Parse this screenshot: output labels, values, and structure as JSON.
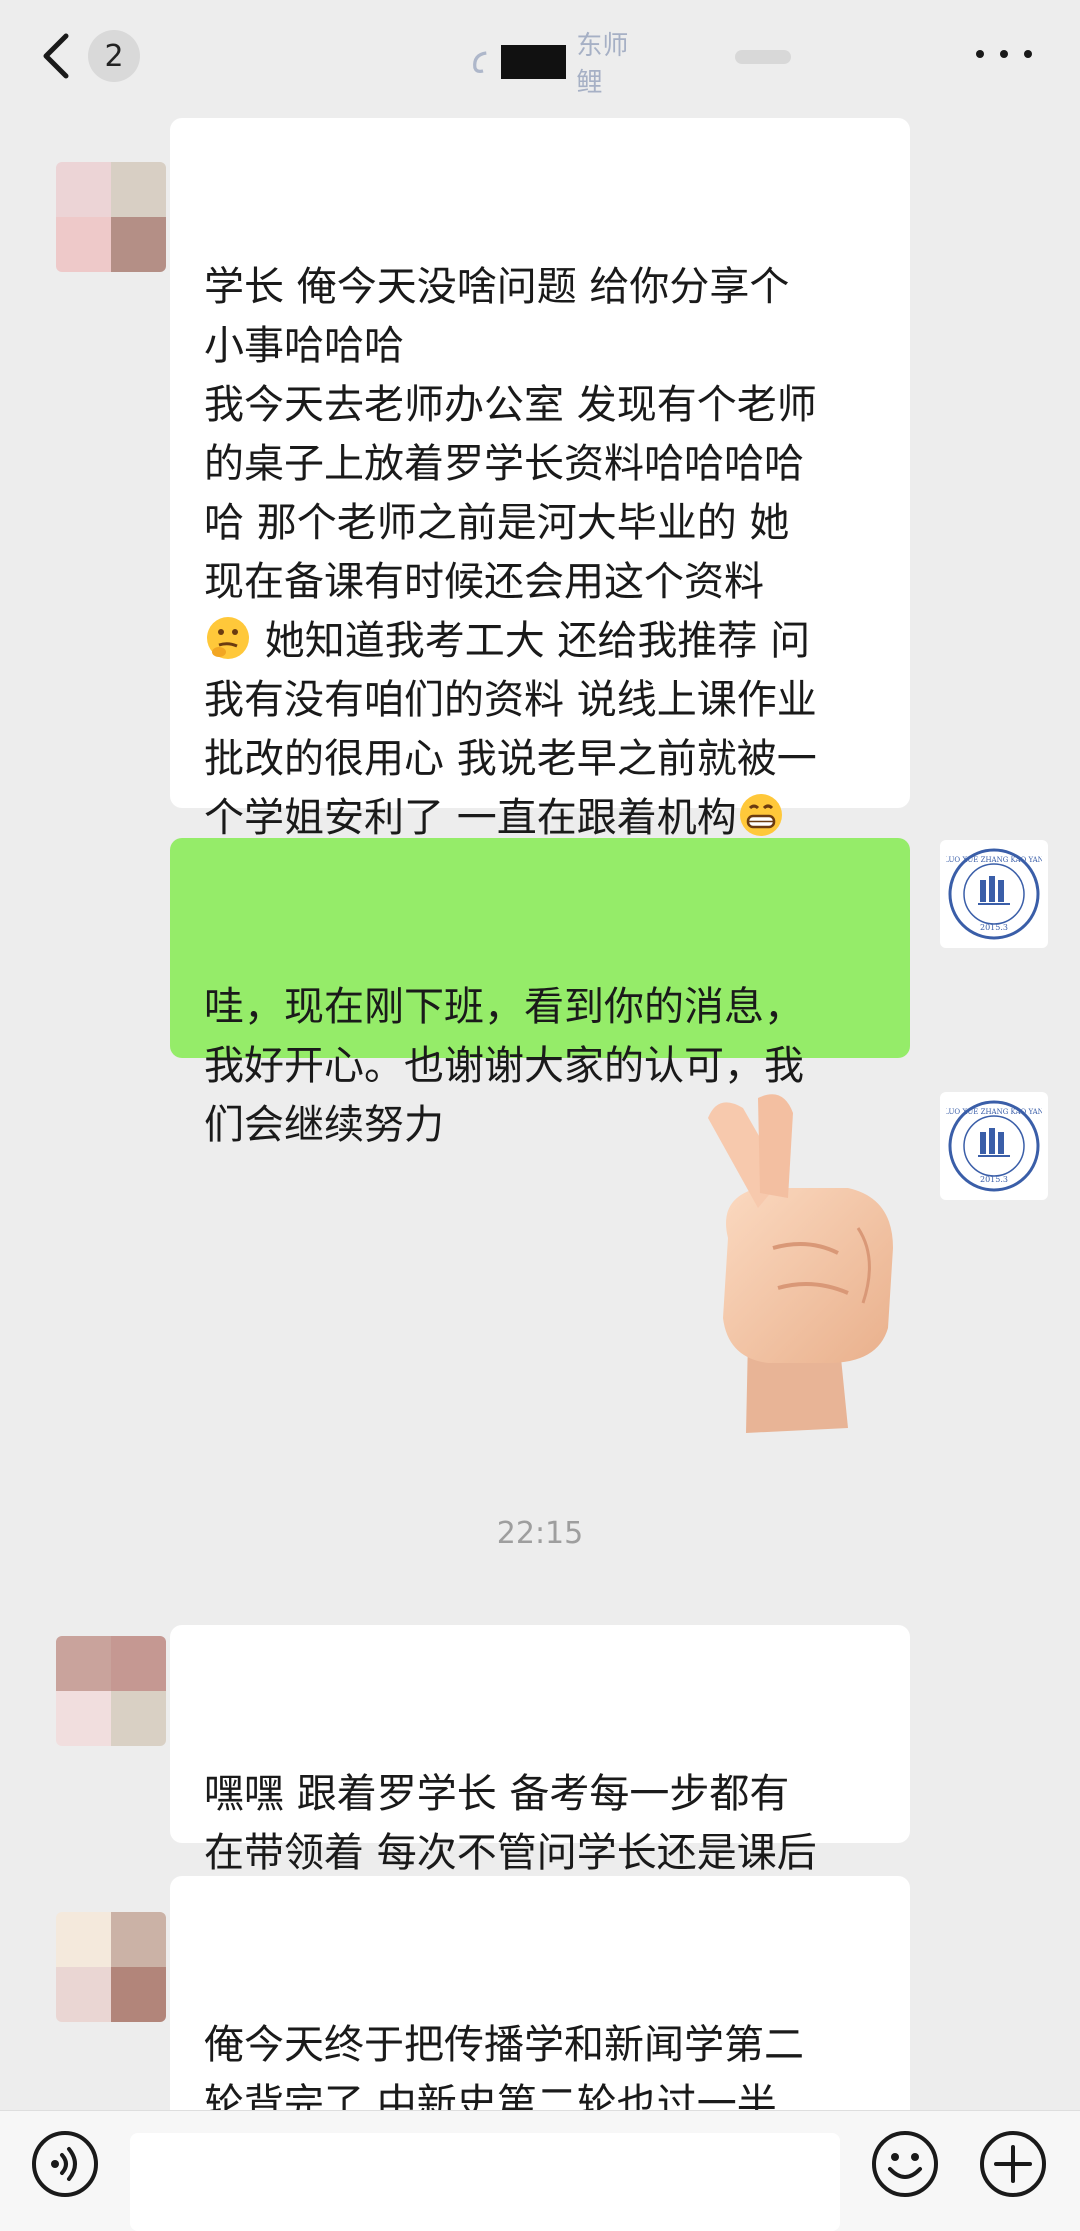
{
  "header": {
    "unread_count": "2",
    "title_visible": "东师鲤",
    "back_icon": "chevron-left-icon",
    "more_icon": "more-dots-icon"
  },
  "messages": {
    "m1_lines": [
      "学长 俺今天没啥问题 给你分享个",
      "小事哈哈哈",
      "我今天去老师办公室 发现有个老师",
      "的桌子上放着罗学长资料哈哈哈哈",
      "哈 那个老师之前是河大毕业的 她",
      "现在备课有时候还会用这个资料"
    ],
    "m1_line7": " 她知道我考工大 还给我推荐 问",
    "m1_line8": "我有没有咱们的资料 说线上课作业",
    "m1_line9": "批改的很用心 我说老早之前就被一",
    "m1_line10": "个学姐安利了 一直在跟着机构",
    "m2": "哇，现在刚下班，看到你的消息，\n我好开心。也谢谢大家的认可，我\n们会继续努力",
    "m3": "嘿嘿 跟着罗学长 备考每一步都有\n在带领着 每次不管问学长还是课后\n问学姐都有很耐心的答复",
    "m4": "俺今天终于把传播学和新闻学第二\n轮背完了 中新史第二轮也过一半\n了 虽然进度不是很快 但感觉比刚\n进九月时候心态上好了很多 答题也"
  },
  "timestamp": "22:15",
  "logo_avatar": {
    "arc_text": "LUO XUE ZHANG KAO YAN",
    "year": "2015.3"
  },
  "input_bar": {
    "placeholder": "",
    "voice_icon": "voice-icon",
    "emoji_icon": "emoji-icon",
    "plus_icon": "plus-icon"
  },
  "colors": {
    "background": "#ededed",
    "bubble_in": "#ffffff",
    "bubble_out": "#95ec69",
    "accent_logo": "#3a5ea8"
  }
}
